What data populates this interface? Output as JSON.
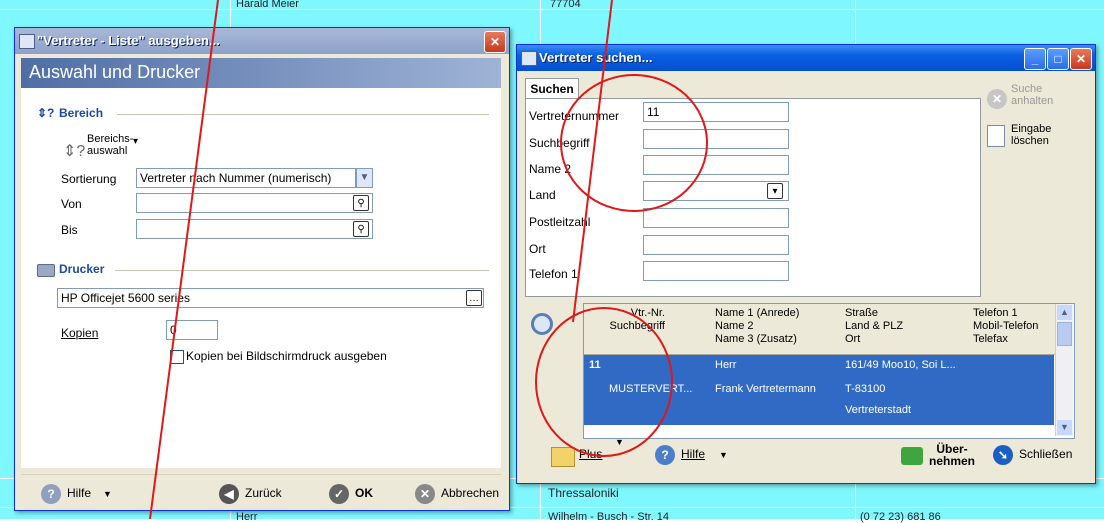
{
  "background": {
    "texts": [
      "Harald Meier",
      "77704",
      "Thressaloniki",
      "Herr",
      "Wilhelm - Busch - Str. 14",
      "(0 72 23) 681 86"
    ]
  },
  "print_dialog": {
    "title": "\"Vertreter - Liste\" ausgeben...",
    "heading": "Auswahl und Drucker",
    "section_range": "Bereich",
    "range_button": "Bereichs-\nauswahl",
    "sort_label": "Sortierung",
    "sort_value": "Vertreter nach Nummer (numerisch)",
    "from_label": "Von",
    "to_label": "Bis",
    "section_printer": "Drucker",
    "printer_value": "HP Officejet 5600 series",
    "copies_label": "Kopien",
    "copies_value": "0",
    "copies_screen_label": "Kopien bei Bildschirmdruck ausgeben",
    "help_label": "Hilfe",
    "back_label": "Zurück",
    "ok_label": "OK",
    "cancel_label": "Abbrechen"
  },
  "search_dialog": {
    "title": "Vertreter suchen...",
    "tab_label": "Suchen",
    "stop_search_label": "Suche\nanhalten",
    "clear_input_label": "Eingabe\nlöschen",
    "fields": [
      {
        "label": "Vertreternummer",
        "value": "11"
      },
      {
        "label": "Suchbegriff",
        "value": ""
      },
      {
        "label": "Name 2",
        "value": ""
      },
      {
        "label": "Land",
        "value": ""
      },
      {
        "label": "Postleitzahl",
        "value": ""
      },
      {
        "label": "Ort",
        "value": ""
      },
      {
        "label": "Telefon 1",
        "value": ""
      }
    ],
    "grid_headers": [
      "Vtr.-Nr.\nSuchbegriff",
      "Name 1 (Anrede)\nName 2\nName 3 (Zusatz)",
      "Straße\nLand & PLZ\nOrt",
      "Telefon 1\nMobil-Telefon\nTelefax"
    ],
    "grid_row": {
      "number": "11",
      "search_term": "MUSTERVERT...",
      "salutation": "Herr",
      "name2": "Frank Vertretermann",
      "street": "161/49 Moo10, Soi L...",
      "plz": "T-83100",
      "city": "Vertreterstadt"
    },
    "plus_label": "Plus",
    "help_label": "Hilfe",
    "take_label": "Über-\nnehmen",
    "close_label": "Schließen"
  },
  "colors": {
    "background_list": "#7ff7ff",
    "selection": "#316ac5",
    "annotation": "#e01818",
    "title_active": "#0a5fe0"
  }
}
